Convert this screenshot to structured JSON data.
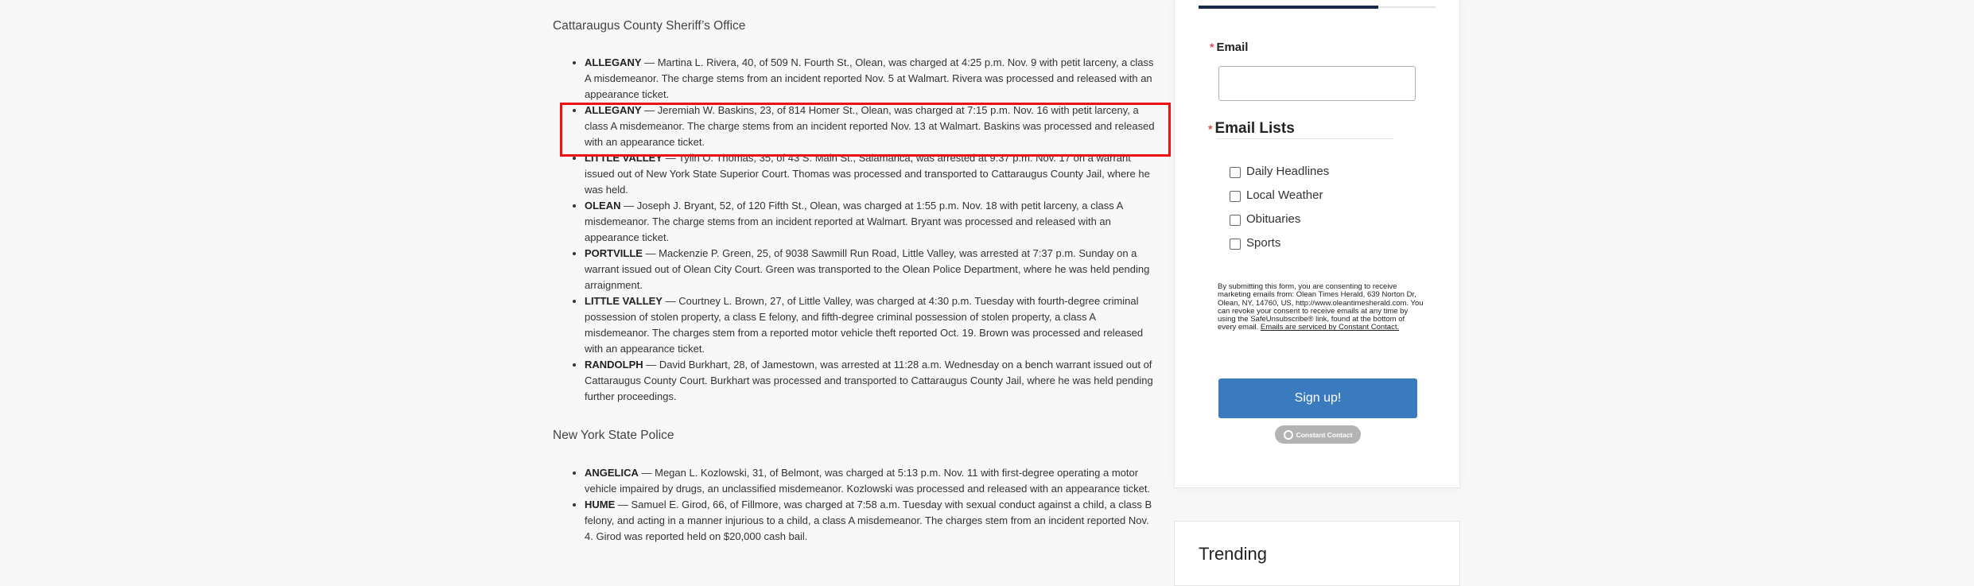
{
  "article": {
    "sections": [
      {
        "heading": "Cattaraugus County Sheriff’s Office",
        "items": [
          {
            "town": "ALLEGANY",
            "text": " — Martina L. Rivera, 40, of 509 N. Fourth St., Olean, was charged at 4:25 p.m. Nov. 9 with petit larceny, a class A misdemeanor. The charge stems from an incident reported Nov. 5 at Walmart. Rivera was processed and released with an appearance ticket."
          },
          {
            "town": "ALLEGANY",
            "text": " — Jeremiah W. Baskins, 23, of 814 Homer St., Olean, was charged at 7:15 p.m. Nov. 16 with petit larceny, a class A misdemeanor. The charge stems from an incident reported Nov. 13 at Walmart. Baskins was processed and released with an appearance ticket."
          },
          {
            "town": "LITTLE VALLEY",
            "text": " — Tylin O. Thomas, 35, of 43 S. Main St., Salamanca, was arrested at 9:37 p.m. Nov. 17 on a warrant issued out of New York State Superior Court. Thomas was processed and transported to Cattaraugus County Jail, where he was held."
          },
          {
            "town": "OLEAN",
            "text": " — Joseph J. Bryant, 52, of 120 Fifth St., Olean, was charged at 1:55 p.m. Nov. 18 with petit larceny, a class A misdemeanor. The charge stems from an incident reported at Walmart. Bryant was processed and released with an appearance ticket."
          },
          {
            "town": "PORTVILLE",
            "text": " — Mackenzie P. Green, 25, of 9038 Sawmill Run Road, Little Valley, was arrested at 7:37 p.m. Sunday on a warrant issued out of Olean City Court. Green was transported to the Olean Police Department, where he was held pending arraignment."
          },
          {
            "town": "LITTLE VALLEY",
            "text": " — Courtney L. Brown, 27, of Little Valley, was charged at 4:30 p.m. Tuesday with fourth-degree criminal possession of stolen property, a class E felony, and fifth-degree criminal possession of stolen property, a class A misdemeanor. The charges stem from a reported motor vehicle theft reported Oct. 19. Brown was processed and released with an appearance ticket."
          },
          {
            "town": "RANDOLPH",
            "text": " — David Burkhart, 28, of Jamestown, was arrested at 11:28 a.m. Wednesday on a bench warrant issued out of Cattaraugus County Court. Burkhart was processed and transported to Cattaraugus County Jail, where he was held pending further proceedings."
          }
        ]
      },
      {
        "heading": "New York State Police",
        "items": [
          {
            "town": "ANGELICA",
            "text": " — Megan L. Kozlowski, 31, of Belmont, was charged at 5:13 p.m. Nov. 11 with first-degree operating a motor vehicle impaired by drugs, an unclassified misdemeanor. Kozlowski was processed and released with an appearance ticket."
          },
          {
            "town": "HUME",
            "text": " — Samuel E. Girod, 66, of Fillmore, was charged at 7:58 a.m. Tuesday with sexual conduct against a child, a class B felony, and acting in a manner injurious to a child, a class A misdemeanor. The charges stem from an incident reported Nov. 4. Girod was reported held on $20,000 cash bail."
          }
        ]
      }
    ],
    "highlight_color": "#ee1111"
  },
  "signup_form": {
    "progress_fraction": 0.76,
    "progress_color": "#19294a",
    "required_mark": "*",
    "email_label": "Email",
    "email_value": "",
    "email_lists_label": "Email Lists",
    "lists": [
      {
        "label": "Daily Headlines",
        "checked": false
      },
      {
        "label": "Local Weather",
        "checked": false
      },
      {
        "label": "Obituaries",
        "checked": false
      },
      {
        "label": "Sports",
        "checked": false
      }
    ],
    "consent_text": "By submitting this form, you are consenting to receive marketing emails from: Olean Times Herald, 639 Norton Dr, Olean, NY, 14760, US, http://www.oleantimesherald.com. You can revoke your consent to receive emails at any time by using the SafeUnsubscribe® link, found at the bottom of every email. ",
    "consent_link": "Emails are serviced by Constant Contact.",
    "submit_label": "Sign up!",
    "submit_color": "#3a7abf",
    "badge_label": "Constant Contact"
  },
  "trending": {
    "title": "Trending"
  }
}
